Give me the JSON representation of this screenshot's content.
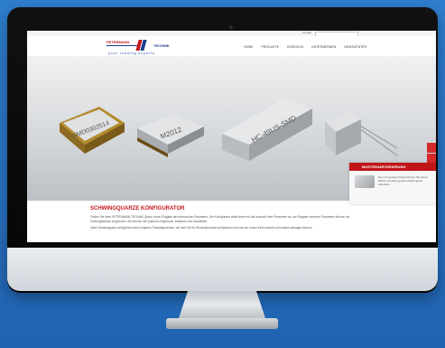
{
  "website": {
    "topbar": {
      "link": "Kontakt",
      "search_placeholder": ""
    },
    "logo": {
      "name_a": "PETERMANN",
      "name_b": "TECHNIK",
      "tagline": "your leading experts"
    },
    "nav": [
      "HOME",
      "PRODUKTE",
      "DESIGN-IN",
      "UNTERNEHMEN",
      "NEWSCENTER"
    ],
    "hero": {
      "components": [
        {
          "label": "SMD0302514"
        },
        {
          "label": "M2012"
        },
        {
          "label": "HC-49US-SMD"
        }
      ]
    },
    "promo": {
      "title": "MUSTERANFORDERUNG",
      "text": "Nur mit wenigen Klicks können Sie sofort Muster für jeden gewünschten Quarz anfordern."
    },
    "content": {
      "heading": "SCHWINGQUARZE KONFIGURATOR",
      "paragraph_1": "Finden Sie ihren PETERMANN-TECHNIK Quarz: einen Eingabe der technischen Parameter. Der Konfigurator bietet Ihnen für die Auswahl Ihrer Parameter an, die Eingabe mehrerer Parameter können die Suchergebnisse eingrenzen. Sie können die Quarzen eingrenzen, bestimmt und auswählen.",
      "paragraph_2": "Jeder Schwingquarz verfügt über einen eigenen Produktgenerator, mit dem Sie Ihr Wunschprodukt konfigurieren und mit nur einem Klick schnell und einfach anfragen können."
    }
  },
  "colors": {
    "brand_red": "#c0161a",
    "brand_blue": "#1a3e8c",
    "background_blue": "#2a74c4"
  }
}
